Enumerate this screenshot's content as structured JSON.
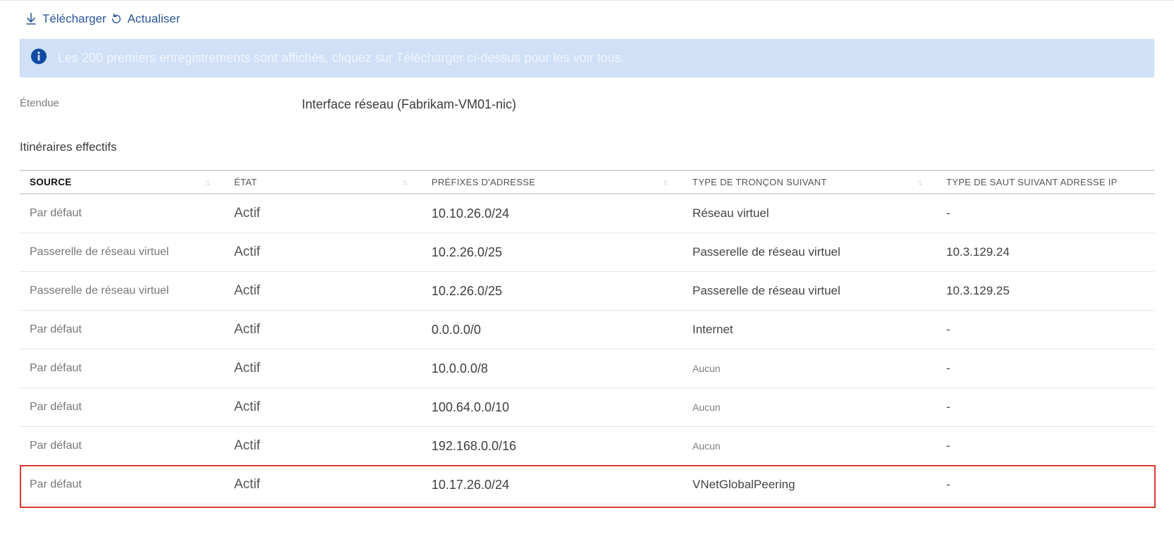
{
  "toolbar": {
    "download_label": "Télécharger",
    "refresh_label": "Actualiser"
  },
  "banner": {
    "message": "Les 200 premiers enregistrements sont affichés, cliquez sur Télécharger ci-dessus pour les voir tous."
  },
  "scope": {
    "label": "Étendue",
    "value": "Interface réseau (Fabrikam-VM01-nic)"
  },
  "section_title": "Itinéraires effectifs",
  "columns": {
    "source": "SOURCE",
    "state": "ÉTAT",
    "prefix": "PRÉFIXES D'ADRESSE",
    "hop_type": "TYPE DE TRONÇON SUIVANT",
    "hop_ip": "TYPE DE SAUT SUIVANT ADRESSE IP"
  },
  "rows": [
    {
      "source": "Par défaut",
      "state": "Actif",
      "prefix": "10.10.26.0/24",
      "hop": "Réseau virtuel",
      "hop_muted": false,
      "ip": "-"
    },
    {
      "source": "Passerelle de réseau virtuel",
      "state": "Actif",
      "prefix": "10.2.26.0/25",
      "hop": "Passerelle de réseau virtuel",
      "hop_muted": false,
      "ip": "10.3.129.24"
    },
    {
      "source": "Passerelle de réseau virtuel",
      "state": "Actif",
      "prefix": "10.2.26.0/25",
      "hop": "Passerelle de réseau virtuel",
      "hop_muted": false,
      "ip": "10.3.129.25"
    },
    {
      "source": "Par défaut",
      "state": "Actif",
      "prefix": "0.0.0.0/0",
      "hop": "Internet",
      "hop_muted": false,
      "ip": "-"
    },
    {
      "source": "Par défaut",
      "state": "Actif",
      "prefix": "10.0.0.0/8",
      "hop": "Aucun",
      "hop_muted": true,
      "ip": "-"
    },
    {
      "source": "Par défaut",
      "state": "Actif",
      "prefix": "100.64.0.0/10",
      "hop": "Aucun",
      "hop_muted": true,
      "ip": "-"
    },
    {
      "source": "Par défaut",
      "state": "Actif",
      "prefix": "192.168.0.0/16",
      "hop": "Aucun",
      "hop_muted": true,
      "ip": "-"
    },
    {
      "source": "Par défaut",
      "state": "Actif",
      "prefix": "10.17.26.0/24",
      "hop": "VNetGlobalPeering",
      "hop_muted": false,
      "ip": "-"
    }
  ],
  "highlight_row_index": 7
}
